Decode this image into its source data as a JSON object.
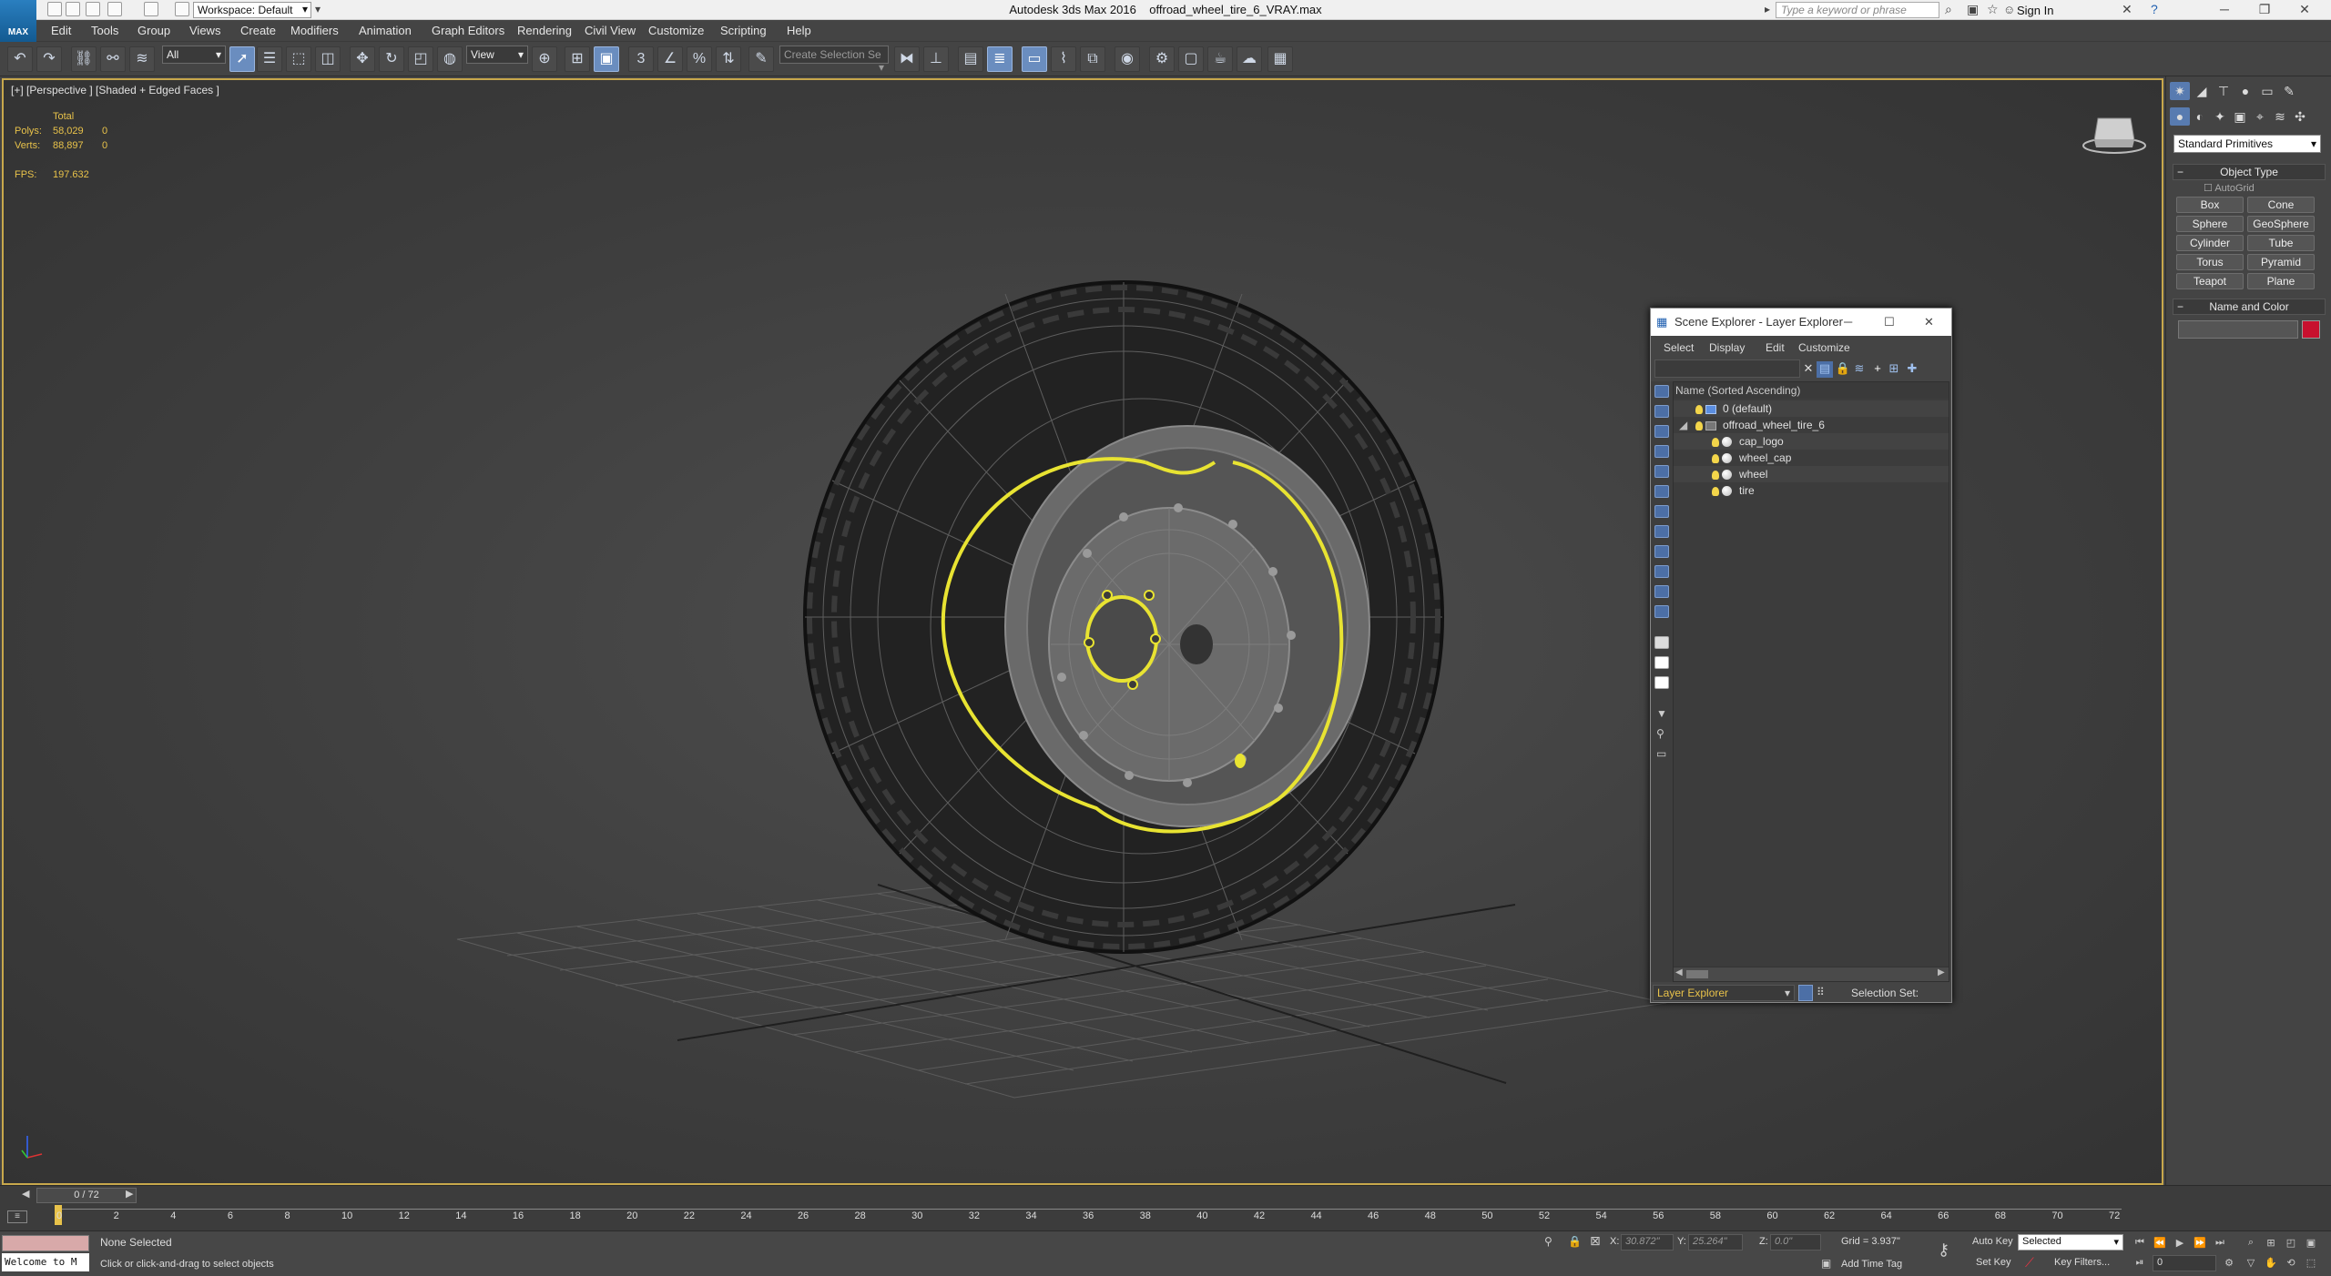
{
  "app": {
    "window_title": "Autodesk 3ds Max 2016",
    "file_name": "offroad_wheel_tire_6_VRAY.max",
    "logo_label": "MAX",
    "workspace": "Workspace: Default",
    "search_placeholder": "Type a keyword or phrase",
    "sign_in": "Sign In"
  },
  "menu": [
    "Edit",
    "Tools",
    "Group",
    "Views",
    "Create",
    "Modifiers",
    "Animation",
    "Graph Editors",
    "Rendering",
    "Civil View",
    "Customize",
    "Scripting",
    "Help"
  ],
  "toolbar": {
    "selection_filter": "All",
    "reference_coord": "View",
    "selection_set_placeholder": "Create Selection Se"
  },
  "viewport": {
    "label": "[+] [Perspective ] [Shaded + Edged Faces ]",
    "stats_header": "Total",
    "polys_label": "Polys:",
    "polys_value": "58,029",
    "polys_sel": "0",
    "verts_label": "Verts:",
    "verts_value": "88,897",
    "verts_sel": "0",
    "fps_label": "FPS:",
    "fps_value": "197.632"
  },
  "command_panel": {
    "category_dropdown": "Standard Primitives",
    "object_type_title": "Object Type",
    "autogrid": "AutoGrid",
    "primitives": [
      "Box",
      "Cone",
      "Sphere",
      "GeoSphere",
      "Cylinder",
      "Tube",
      "Torus",
      "Pyramid",
      "Teapot",
      "Plane"
    ],
    "name_color_title": "Name and Color",
    "color": "#c8102e"
  },
  "scene_explorer": {
    "title": "Scene Explorer - Layer Explorer",
    "menus": [
      "Select",
      "Display",
      "Edit",
      "Customize"
    ],
    "column_header": "Name (Sorted Ascending)",
    "rows": [
      {
        "name": "0 (default)",
        "kind": "layer"
      },
      {
        "name": "offroad_wheel_tire_6",
        "kind": "layer"
      },
      {
        "name": "cap_logo",
        "kind": "object"
      },
      {
        "name": "wheel_cap",
        "kind": "object"
      },
      {
        "name": "wheel",
        "kind": "object"
      },
      {
        "name": "tire",
        "kind": "object"
      }
    ],
    "explorer_type": "Layer Explorer",
    "selection_set_label": "Selection Set:"
  },
  "timeline": {
    "frame_display": "0 / 72",
    "ticks": [
      "0",
      "2",
      "4",
      "6",
      "8",
      "10",
      "12",
      "14",
      "16",
      "18",
      "20",
      "22",
      "24",
      "26",
      "28",
      "30",
      "32",
      "34",
      "36",
      "38",
      "40",
      "42",
      "44",
      "46",
      "48",
      "50",
      "52",
      "54",
      "56",
      "58",
      "60",
      "62",
      "64",
      "66",
      "68",
      "70",
      "72"
    ]
  },
  "status": {
    "welcome_text": "Welcome to M",
    "selection": "None Selected",
    "prompt": "Click or click-and-drag to select objects",
    "x_label": "X:",
    "x_value": "30.872\"",
    "y_label": "Y:",
    "y_value": "25.264\"",
    "z_label": "Z:",
    "z_value": "0.0\"",
    "grid": "Grid = 3.937\"",
    "add_time_tag": "Add Time Tag",
    "auto_key": "Auto Key",
    "auto_key_mode": "Selected",
    "set_key": "Set Key",
    "key_filters": "Key Filters...",
    "current_frame": "0"
  }
}
